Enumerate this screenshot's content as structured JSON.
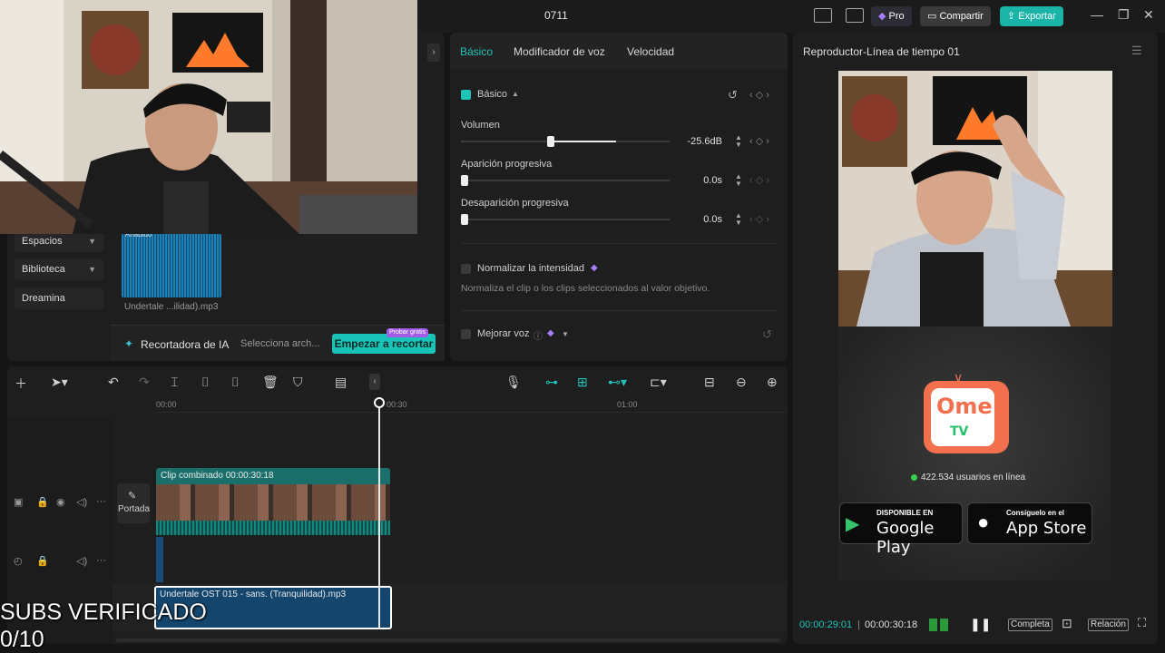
{
  "window": {
    "title": "0711",
    "pro_label": "Pro",
    "share_label": "Compartir",
    "export_label": "Exportar"
  },
  "media": {
    "sidebar": [
      {
        "label": "Espacios"
      },
      {
        "label": "Biblioteca"
      },
      {
        "label": "Dreamina"
      }
    ],
    "thumb_top_label": "Añadido",
    "file_name": "Undertale ...ilidad).mp3",
    "ai_cutter_label": "Recortadora de IA",
    "ai_select_placeholder": "Selecciona arch...",
    "ai_start_label": "Empezar a recortar",
    "ai_badge": "Probar gratis"
  },
  "props": {
    "tabs": [
      "Básico",
      "Modificador de voz",
      "Velocidad"
    ],
    "section_label": "Básico",
    "volume_label": "Volumen",
    "volume_value": "-25.6dB",
    "volume_level": 0.58,
    "fade_in_label": "Aparición progresiva",
    "fade_in_value": "0.0s",
    "fade_out_label": "Desaparición progresiva",
    "fade_out_value": "0.0s",
    "normalize_label": "Normalizar la intensidad",
    "normalize_desc": "Normaliza el clip o los clips seleccionados al valor objetivo.",
    "enhance_label": "Mejorar voz"
  },
  "player": {
    "title": "Reproductor-Línea de tiempo 01",
    "ome_logo_text": "Ome",
    "ome_logo_sub": "TV",
    "online_text": "422.534 usuarios en línea",
    "google_small": "DISPONIBLE EN",
    "google_big": "Google Play",
    "apple_small": "Consíguelo en el",
    "apple_big": "App Store",
    "time_current": "00:00:29:01",
    "time_total": "00:00:30:18",
    "full_label": "Completa",
    "ratio_label": "Relación"
  },
  "timeline": {
    "ticks": [
      "00:00",
      "00:30",
      "01:00"
    ],
    "cover_label": "Portada",
    "clip_label": "Clip combinado  00:00:30:18",
    "audio_label": "Undertale OST 015 - sans. (Tranquilidad).mp3"
  },
  "overlay": {
    "line1": "SUBS VERIFICADO",
    "line2": "0/10"
  },
  "colors": {
    "accent": "#1fc4b8",
    "export": "#1bb5a8",
    "audio_clip": "#13456d"
  }
}
